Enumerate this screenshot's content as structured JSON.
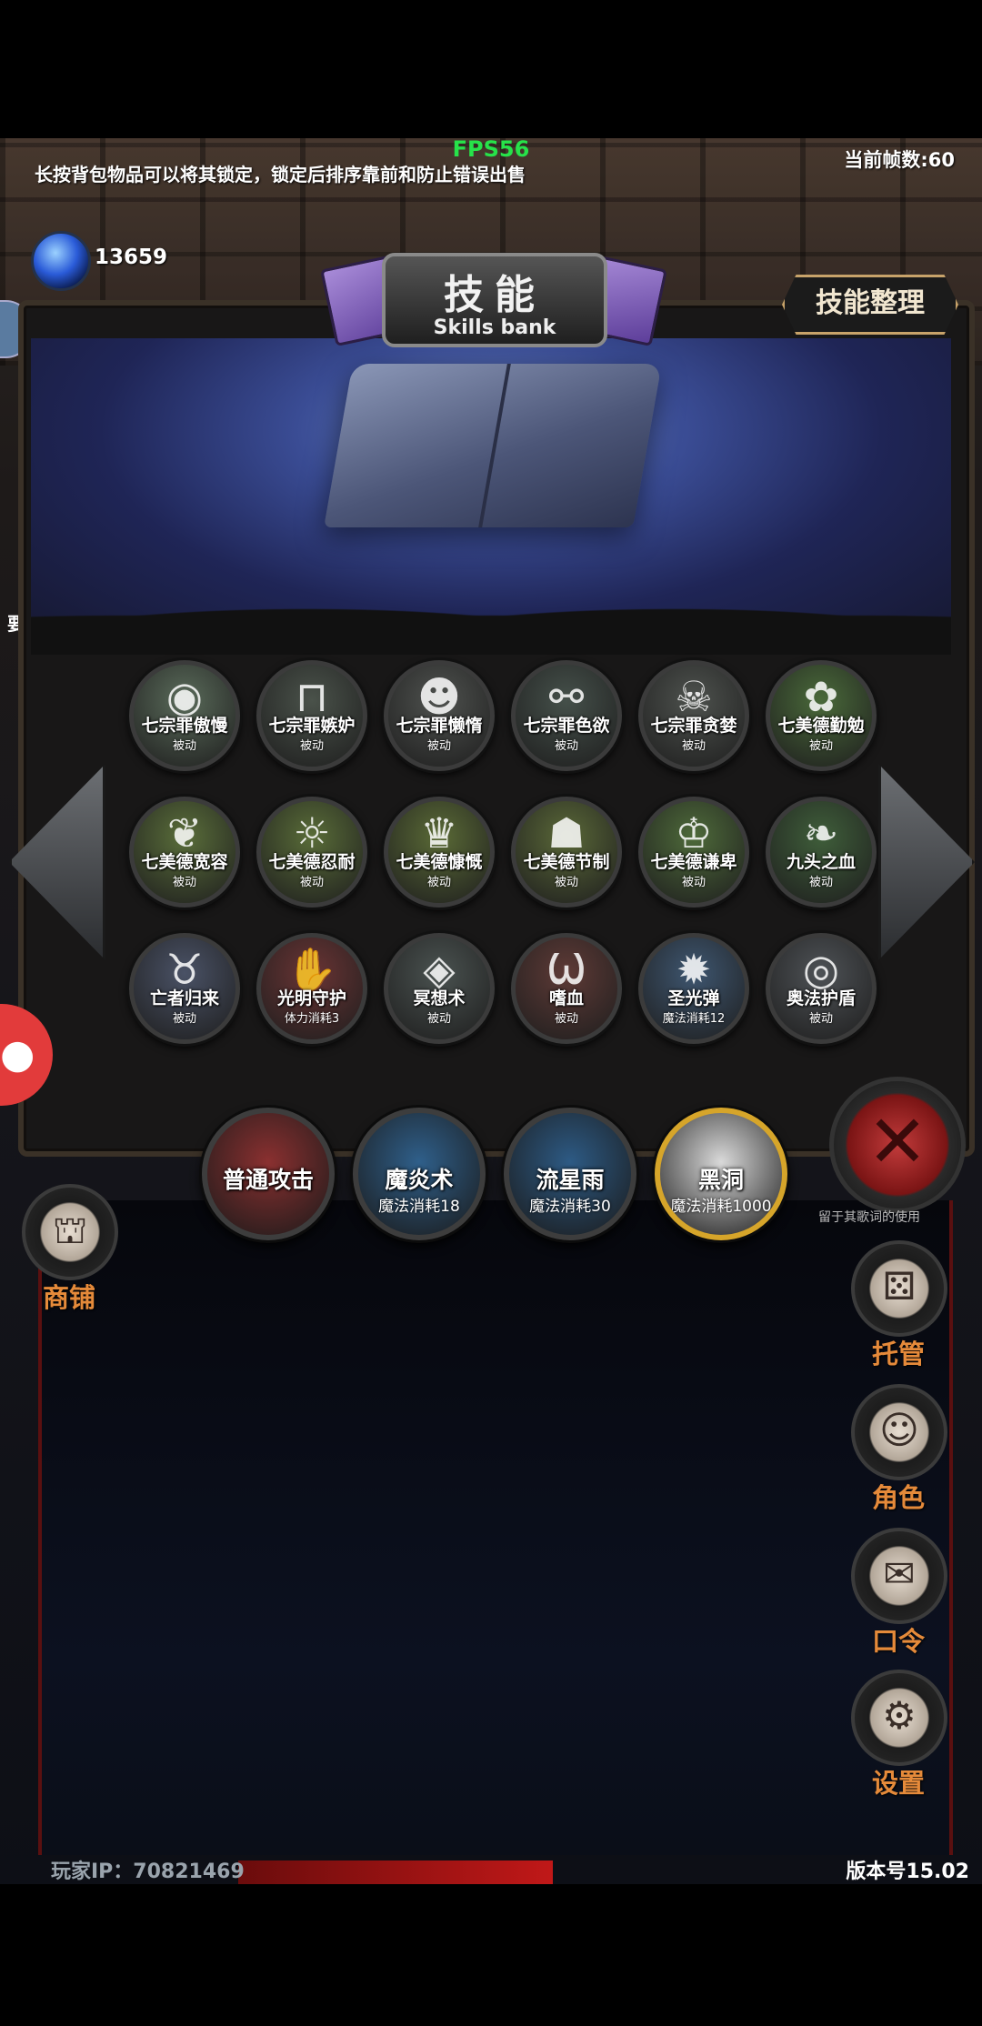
{
  "fps": "FPS56",
  "tip": "长按背包物品可以将其锁定，锁定后排序靠前和防止错误出售",
  "frame_count": "当前帧数:60",
  "currency": {
    "amount": "13659",
    "icon": "blue-gem-icon"
  },
  "side_label_left": "要",
  "panel": {
    "title_cn": "技能",
    "title_en": "Skills bank",
    "organize_label": "技能整理"
  },
  "skills": [
    {
      "name": "七宗罪傲慢",
      "sub": "被动",
      "glyph": "◉",
      "color": "#5a6b5a"
    },
    {
      "name": "七宗罪嫉妒",
      "sub": "被动",
      "glyph": "⊓",
      "color": "#4a524a"
    },
    {
      "name": "七宗罪懒惰",
      "sub": "被动",
      "glyph": "☻",
      "color": "#4f524f"
    },
    {
      "name": "七宗罪色欲",
      "sub": "被动",
      "glyph": "⚯",
      "color": "#45504a"
    },
    {
      "name": "七宗罪贪婪",
      "sub": "被动",
      "glyph": "☠",
      "color": "#4e524e"
    },
    {
      "name": "七美德勤勉",
      "sub": "被动",
      "glyph": "✿",
      "color": "#4a6a3a"
    },
    {
      "name": "七美德宽容",
      "sub": "被动",
      "glyph": "❦",
      "color": "#5a6e3a"
    },
    {
      "name": "七美德忍耐",
      "sub": "被动",
      "glyph": "☼",
      "color": "#596c38"
    },
    {
      "name": "七美德慷慨",
      "sub": "被动",
      "glyph": "♛",
      "color": "#5a6a36"
    },
    {
      "name": "七美德节制",
      "sub": "被动",
      "glyph": "☗",
      "color": "#5a6838"
    },
    {
      "name": "七美德谦卑",
      "sub": "被动",
      "glyph": "♔",
      "color": "#4e6a3a"
    },
    {
      "name": "九头之血",
      "sub": "被动",
      "glyph": "❧",
      "color": "#3f5e3a"
    },
    {
      "name": "亡者归来",
      "sub": "被动",
      "glyph": "♉",
      "color": "#4a5266"
    },
    {
      "name": "光明守护",
      "sub": "体力消耗3",
      "glyph": "✋",
      "color": "#6a3434"
    },
    {
      "name": "冥想术",
      "sub": "被动",
      "glyph": "◈",
      "color": "#4a5250"
    },
    {
      "name": "嗜血",
      "sub": "被动",
      "glyph": "Ѡ",
      "color": "#5e3a36"
    },
    {
      "name": "圣光弹",
      "sub": "魔法消耗12",
      "glyph": "✹",
      "color": "#3e5670"
    },
    {
      "name": "奥法护盾",
      "sub": "被动",
      "glyph": "◎",
      "color": "#4e5256"
    }
  ],
  "active_skills": [
    {
      "name": "普通攻击",
      "sub": "",
      "glyph": "⚔",
      "color": "#8a3030"
    },
    {
      "name": "魔炎术",
      "sub": "魔法消耗18",
      "glyph": "✦",
      "color": "#2f5f8a"
    },
    {
      "name": "流星雨",
      "sub": "魔法消耗30",
      "glyph": "☄",
      "color": "#2d5a84"
    },
    {
      "name": "黑洞",
      "sub": "魔法消耗1000",
      "glyph": "◍",
      "color": "#d9d9d9"
    }
  ],
  "close_hint": "留于其歌词的使用",
  "side_menu": [
    {
      "label": "商铺",
      "icon": "shop-icon",
      "glyph": "⛫"
    },
    {
      "label": "托管",
      "icon": "dice-icon",
      "glyph": "⚄"
    },
    {
      "label": "角色",
      "icon": "character-icon",
      "glyph": "☺"
    },
    {
      "label": "口令",
      "icon": "scroll-icon",
      "glyph": "✉"
    },
    {
      "label": "设置",
      "icon": "gear-icon",
      "glyph": "⚙"
    }
  ],
  "player_ip": "玩家IP：70821469",
  "version": "版本号15.02"
}
